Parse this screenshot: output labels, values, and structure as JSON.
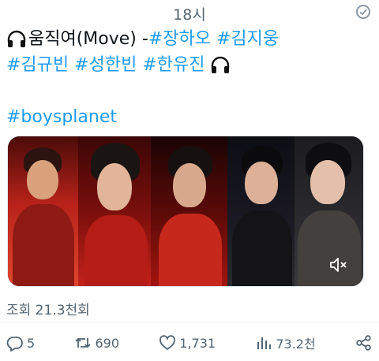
{
  "status": {
    "time": "18시"
  },
  "tweet": {
    "line1_text": "움직여(Move) - ",
    "line1_tags": [
      "#장하오",
      "#김지웅"
    ],
    "line2_tags": [
      "#김규빈",
      "#성한빈",
      "#한유진"
    ],
    "line3_tag": "#boysplanet",
    "headphone_icon": "headphones-icon"
  },
  "media": {
    "panels": 5,
    "mute_icon": "speaker-muted-icon"
  },
  "stats": {
    "views_label": "조회 21.3천회"
  },
  "actions": {
    "replies": "5",
    "retweets": "690",
    "likes": "1,731",
    "views": "73.2천"
  },
  "colors": {
    "link": "#1d9bf0",
    "muted": "#536471"
  }
}
